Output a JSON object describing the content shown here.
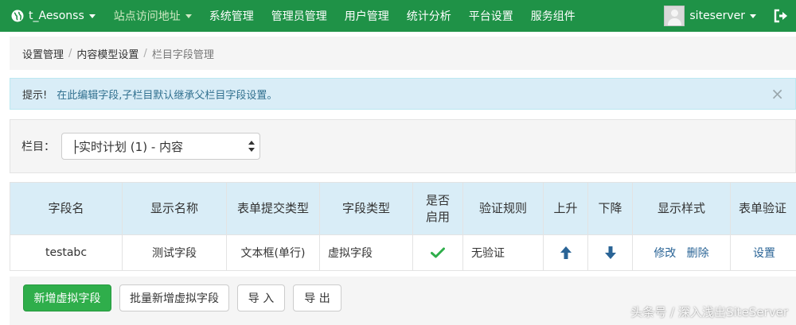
{
  "navbar": {
    "brand_label": "t_Aesonss",
    "items": [
      {
        "label": "站点访问地址"
      },
      {
        "label": "系统管理"
      },
      {
        "label": "管理员管理"
      },
      {
        "label": "用户管理"
      },
      {
        "label": "统计分析"
      },
      {
        "label": "平台设置"
      },
      {
        "label": "服务组件"
      }
    ],
    "username": "siteserver"
  },
  "breadcrumb": {
    "items": [
      "设置管理",
      "内容模型设置",
      "栏目字段管理"
    ],
    "separator": "/"
  },
  "alert": {
    "lead": "提示!",
    "message": "在此编辑字段,子栏目默认继承父栏目字段设置。",
    "close": "×"
  },
  "filter": {
    "label": "栏目：",
    "selected": "├实时计划 (1) - 内容"
  },
  "table": {
    "headers": [
      "字段名",
      "显示名称",
      "表单提交类型",
      "字段类型",
      "是否启用",
      "验证规则",
      "上升",
      "下降",
      "显示样式",
      "表单验证"
    ],
    "rows": [
      {
        "field_name": "testabc",
        "display_name": "测试字段",
        "submit_type": "文本框(单行)",
        "field_type": "虚拟字段",
        "enabled": true,
        "validation": "无验证",
        "style_edit": "修改",
        "style_delete": "删除",
        "form_validate": "设置"
      }
    ]
  },
  "actions": {
    "add_virtual": "新增虚拟字段",
    "batch_add_virtual": "批量新增虚拟字段",
    "import": "导 入",
    "export": "导 出"
  },
  "watermark": "头条号 / 深入浅出SiteServer",
  "colors": {
    "navbar": "#1f9247",
    "primary_button": "#2fae4b",
    "table_header": "#d9edf7",
    "link": "#2a6496",
    "check": "#2fae4b"
  }
}
